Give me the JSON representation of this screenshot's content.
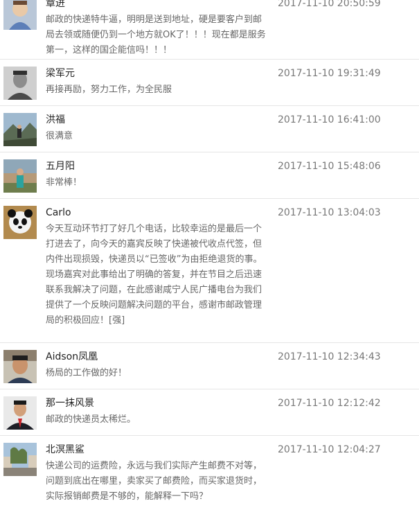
{
  "comments": [
    {
      "name": "章进",
      "time": "2017-11-10 20:50:59",
      "text": "邮政的快递特牛逼，明明是送到地址，硬是要客户到邮局去领或随便仍到一个地方就OK了！！！现在都是服务第一，这样的国企能信吗！！！",
      "avatar_icon": "child-photo-avatar"
    },
    {
      "name": "梁军元",
      "time": "2017-11-10 19:31:49",
      "text": "再接再励，努力工作，为全民服",
      "avatar_icon": "bw-portrait-avatar"
    },
    {
      "name": "洪福",
      "time": "2017-11-10 16:41:00",
      "text": "很满意",
      "avatar_icon": "landscape-person-avatar"
    },
    {
      "name": "五月阳",
      "time": "2017-11-10 15:48:06",
      "text": "非常棒！",
      "avatar_icon": "outdoor-person-avatar"
    },
    {
      "name": "Carlo",
      "time": "2017-11-10 13:04:03",
      "text": "今天互动环节打了好几个电话，比较幸运的是最后一个打进去了，向今天的嘉宾反映了快递被代收点代签，但内件出现损毁，快递员以“已签收”为由拒绝退货的事。现场嘉宾对此事给出了明确的答复，并在节目之后迅速联系我解决了问题，在此感谢咸宁人民广播电台为我们提供了一个反映问题解决问题的平台，感谢市邮政管理局的积极回应！[强]",
      "avatar_icon": "panda-toy-avatar"
    },
    {
      "name": "Aidson凤凰",
      "time": "2017-11-10 12:34:43",
      "text": "杨局的工作做的好！",
      "avatar_icon": "man-portrait-avatar"
    },
    {
      "name": "那一抹风景",
      "time": "2017-11-10 12:12:42",
      "text": "邮政的快递员太稀烂。",
      "avatar_icon": "man-suit-avatar"
    },
    {
      "name": "北溟黑鲨",
      "time": "2017-11-10 12:04:27",
      "text": "快递公司的运费险，永远与我们实际产生邮费不对等，问题到底出在哪里，卖家买了邮费险，而买家退货时，实际报销邮费是不够的，能解释一下吗？",
      "avatar_icon": "street-scene-avatar"
    }
  ]
}
